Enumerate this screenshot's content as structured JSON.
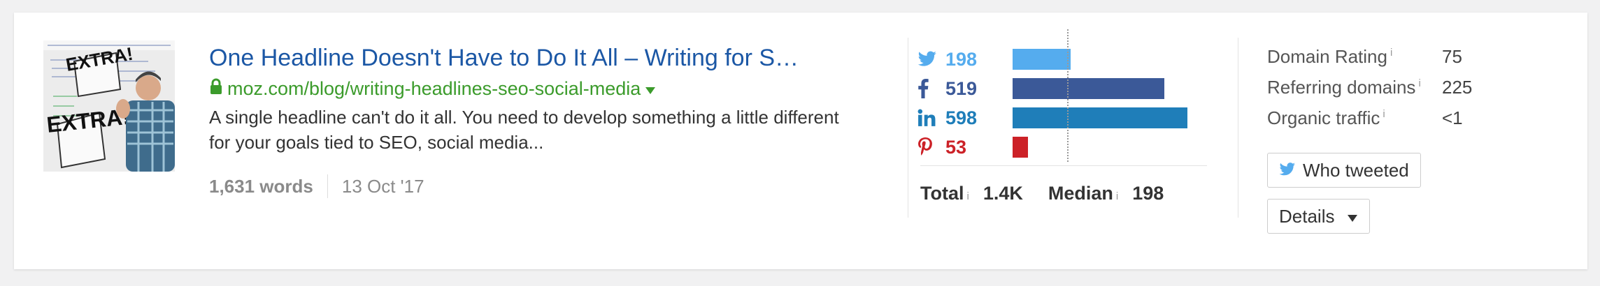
{
  "article": {
    "title": "One Headline Doesn't Have to Do It All – Writing for S…",
    "url": "moz.com/blog/writing-headlines-seo-social-media",
    "description": "A single headline can't do it all. You need to develop something a little different for your goals tied to SEO, social media...",
    "words": "1,631 words",
    "date": "13 Oct '17",
    "thumbnail_text": "EXTRA!"
  },
  "social": {
    "twitter": {
      "value": "198",
      "color": "#55acee",
      "icon": "twitter-icon",
      "count": 198
    },
    "facebook": {
      "value": "519",
      "color": "#3b5998",
      "icon": "facebook-icon",
      "count": 519
    },
    "linkedin": {
      "value": "598",
      "color": "#1f7eb9",
      "icon": "linkedin-icon",
      "count": 598
    },
    "pinterest": {
      "value": "53",
      "color": "#cc2127",
      "icon": "pinterest-icon",
      "count": 53
    },
    "total_label": "Total",
    "total_value": "1.4K",
    "median_label": "Median",
    "median_value": "198",
    "info_marker": "i"
  },
  "metrics": {
    "domain_rating_label": "Domain Rating",
    "domain_rating_value": "75",
    "referring_domains_label": "Referring domains",
    "referring_domains_value": "225",
    "organic_traffic_label": "Organic traffic",
    "organic_traffic_value": "<1"
  },
  "buttons": {
    "who_tweeted": "Who tweeted",
    "details": "Details"
  }
}
